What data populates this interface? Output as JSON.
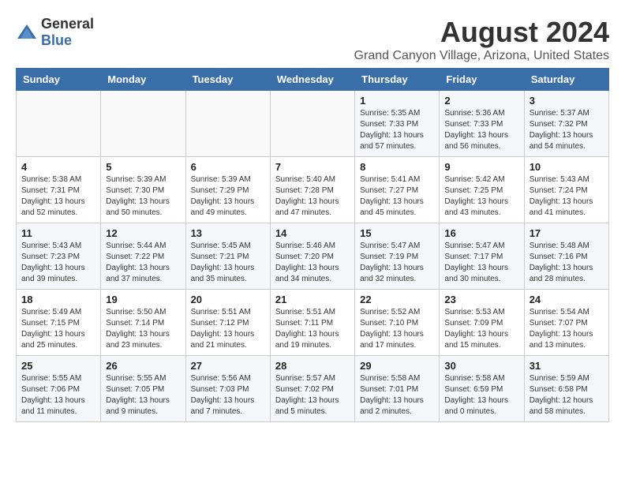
{
  "logo": {
    "general": "General",
    "blue": "Blue"
  },
  "title": "August 2024",
  "subtitle": "Grand Canyon Village, Arizona, United States",
  "days_of_week": [
    "Sunday",
    "Monday",
    "Tuesday",
    "Wednesday",
    "Thursday",
    "Friday",
    "Saturday"
  ],
  "weeks": [
    [
      {
        "day": "",
        "info": ""
      },
      {
        "day": "",
        "info": ""
      },
      {
        "day": "",
        "info": ""
      },
      {
        "day": "",
        "info": ""
      },
      {
        "day": "1",
        "info": "Sunrise: 5:35 AM\nSunset: 7:33 PM\nDaylight: 13 hours\nand 57 minutes."
      },
      {
        "day": "2",
        "info": "Sunrise: 5:36 AM\nSunset: 7:33 PM\nDaylight: 13 hours\nand 56 minutes."
      },
      {
        "day": "3",
        "info": "Sunrise: 5:37 AM\nSunset: 7:32 PM\nDaylight: 13 hours\nand 54 minutes."
      }
    ],
    [
      {
        "day": "4",
        "info": "Sunrise: 5:38 AM\nSunset: 7:31 PM\nDaylight: 13 hours\nand 52 minutes."
      },
      {
        "day": "5",
        "info": "Sunrise: 5:39 AM\nSunset: 7:30 PM\nDaylight: 13 hours\nand 50 minutes."
      },
      {
        "day": "6",
        "info": "Sunrise: 5:39 AM\nSunset: 7:29 PM\nDaylight: 13 hours\nand 49 minutes."
      },
      {
        "day": "7",
        "info": "Sunrise: 5:40 AM\nSunset: 7:28 PM\nDaylight: 13 hours\nand 47 minutes."
      },
      {
        "day": "8",
        "info": "Sunrise: 5:41 AM\nSunset: 7:27 PM\nDaylight: 13 hours\nand 45 minutes."
      },
      {
        "day": "9",
        "info": "Sunrise: 5:42 AM\nSunset: 7:25 PM\nDaylight: 13 hours\nand 43 minutes."
      },
      {
        "day": "10",
        "info": "Sunrise: 5:43 AM\nSunset: 7:24 PM\nDaylight: 13 hours\nand 41 minutes."
      }
    ],
    [
      {
        "day": "11",
        "info": "Sunrise: 5:43 AM\nSunset: 7:23 PM\nDaylight: 13 hours\nand 39 minutes."
      },
      {
        "day": "12",
        "info": "Sunrise: 5:44 AM\nSunset: 7:22 PM\nDaylight: 13 hours\nand 37 minutes."
      },
      {
        "day": "13",
        "info": "Sunrise: 5:45 AM\nSunset: 7:21 PM\nDaylight: 13 hours\nand 35 minutes."
      },
      {
        "day": "14",
        "info": "Sunrise: 5:46 AM\nSunset: 7:20 PM\nDaylight: 13 hours\nand 34 minutes."
      },
      {
        "day": "15",
        "info": "Sunrise: 5:47 AM\nSunset: 7:19 PM\nDaylight: 13 hours\nand 32 minutes."
      },
      {
        "day": "16",
        "info": "Sunrise: 5:47 AM\nSunset: 7:17 PM\nDaylight: 13 hours\nand 30 minutes."
      },
      {
        "day": "17",
        "info": "Sunrise: 5:48 AM\nSunset: 7:16 PM\nDaylight: 13 hours\nand 28 minutes."
      }
    ],
    [
      {
        "day": "18",
        "info": "Sunrise: 5:49 AM\nSunset: 7:15 PM\nDaylight: 13 hours\nand 25 minutes."
      },
      {
        "day": "19",
        "info": "Sunrise: 5:50 AM\nSunset: 7:14 PM\nDaylight: 13 hours\nand 23 minutes."
      },
      {
        "day": "20",
        "info": "Sunrise: 5:51 AM\nSunset: 7:12 PM\nDaylight: 13 hours\nand 21 minutes."
      },
      {
        "day": "21",
        "info": "Sunrise: 5:51 AM\nSunset: 7:11 PM\nDaylight: 13 hours\nand 19 minutes."
      },
      {
        "day": "22",
        "info": "Sunrise: 5:52 AM\nSunset: 7:10 PM\nDaylight: 13 hours\nand 17 minutes."
      },
      {
        "day": "23",
        "info": "Sunrise: 5:53 AM\nSunset: 7:09 PM\nDaylight: 13 hours\nand 15 minutes."
      },
      {
        "day": "24",
        "info": "Sunrise: 5:54 AM\nSunset: 7:07 PM\nDaylight: 13 hours\nand 13 minutes."
      }
    ],
    [
      {
        "day": "25",
        "info": "Sunrise: 5:55 AM\nSunset: 7:06 PM\nDaylight: 13 hours\nand 11 minutes."
      },
      {
        "day": "26",
        "info": "Sunrise: 5:55 AM\nSunset: 7:05 PM\nDaylight: 13 hours\nand 9 minutes."
      },
      {
        "day": "27",
        "info": "Sunrise: 5:56 AM\nSunset: 7:03 PM\nDaylight: 13 hours\nand 7 minutes."
      },
      {
        "day": "28",
        "info": "Sunrise: 5:57 AM\nSunset: 7:02 PM\nDaylight: 13 hours\nand 5 minutes."
      },
      {
        "day": "29",
        "info": "Sunrise: 5:58 AM\nSunset: 7:01 PM\nDaylight: 13 hours\nand 2 minutes."
      },
      {
        "day": "30",
        "info": "Sunrise: 5:58 AM\nSunset: 6:59 PM\nDaylight: 13 hours\nand 0 minutes."
      },
      {
        "day": "31",
        "info": "Sunrise: 5:59 AM\nSunset: 6:58 PM\nDaylight: 12 hours\nand 58 minutes."
      }
    ]
  ]
}
